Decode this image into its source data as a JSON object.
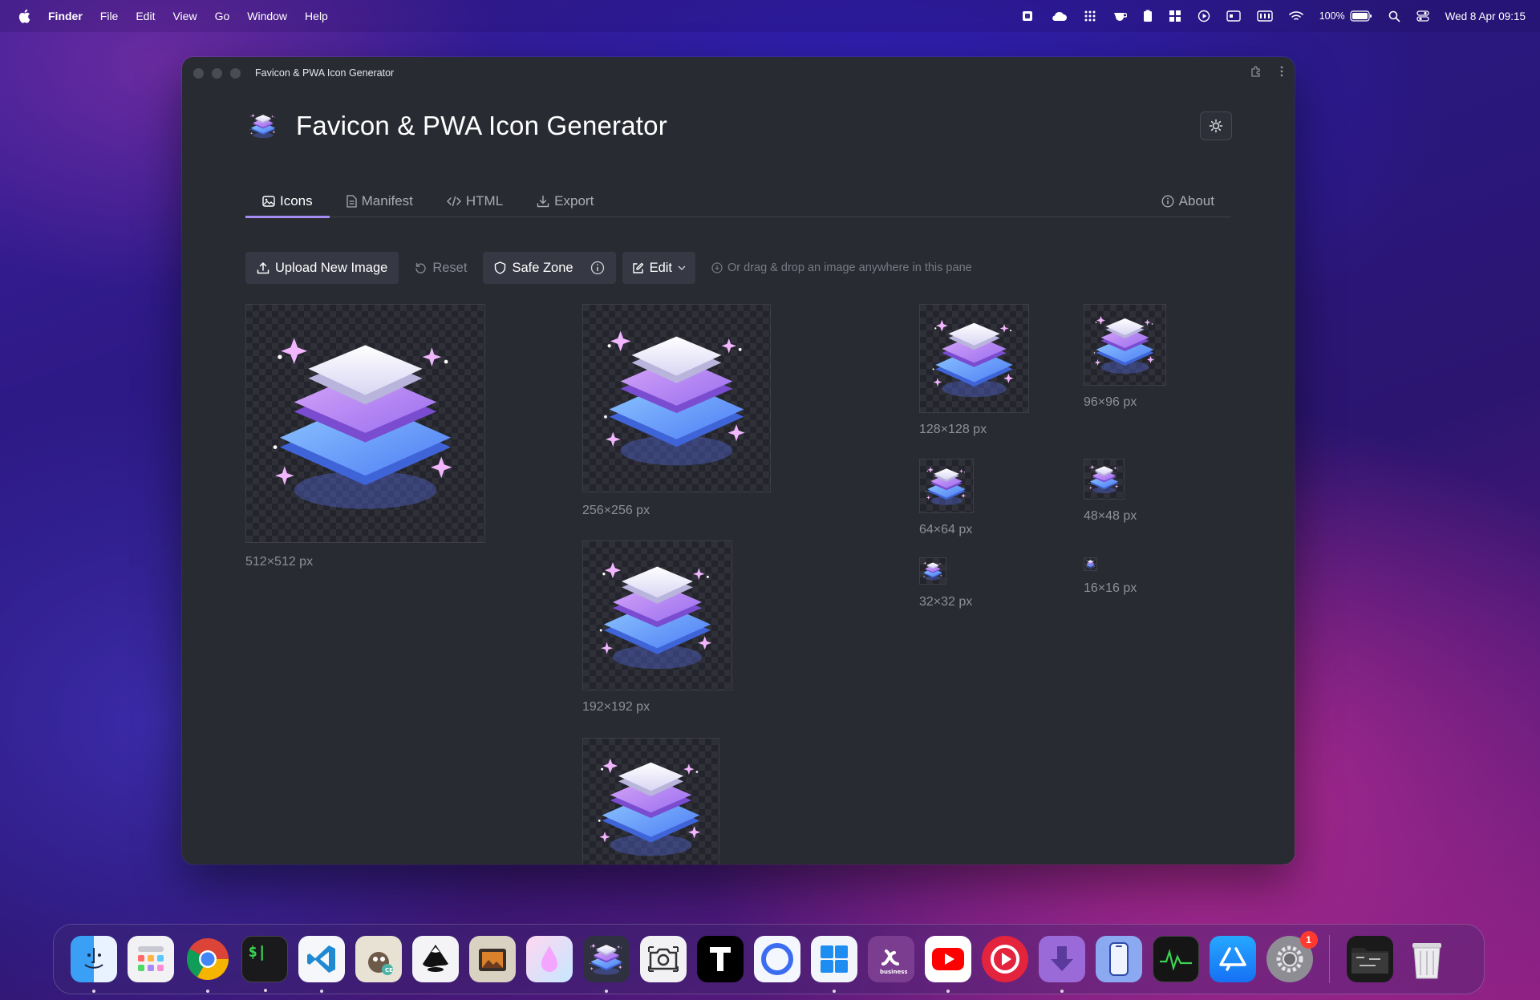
{
  "menubar": {
    "app_name": "Finder",
    "menus": [
      "File",
      "Edit",
      "View",
      "Go",
      "Window",
      "Help"
    ],
    "battery": "100%",
    "datetime": "Wed 8 Apr  09:15"
  },
  "window": {
    "title": "Favicon & PWA Icon Generator"
  },
  "header": {
    "title": "Favicon & PWA Icon Generator"
  },
  "tabs": [
    {
      "label": "Icons",
      "icon": "image-icon",
      "active": true
    },
    {
      "label": "Manifest",
      "icon": "document-icon",
      "active": false
    },
    {
      "label": "HTML",
      "icon": "code-icon",
      "active": false
    },
    {
      "label": "Export",
      "icon": "download-icon",
      "active": false
    }
  ],
  "about_tab": {
    "label": "About",
    "icon": "info-icon"
  },
  "toolbar": {
    "upload_label": "Upload New Image",
    "reset_label": "Reset",
    "safe_zone_label": "Safe Zone",
    "edit_label": "Edit",
    "hint": "Or drag & drop an image anywhere in this pane"
  },
  "previews": [
    {
      "label": "512×512 px"
    },
    {
      "label": "256×256 px"
    },
    {
      "label": "192×192 px"
    },
    {
      "label": "128×128 px"
    },
    {
      "label": "96×96 px"
    },
    {
      "label": "64×64 px"
    },
    {
      "label": "48×48 px"
    },
    {
      "label": "32×32 px"
    },
    {
      "label": "16×16 px"
    },
    {
      "label": ""
    }
  ],
  "dock": {
    "apps": [
      "Finder",
      "Launchpad",
      "Chrome",
      "Terminal",
      "VS Code",
      "GIMP",
      "Inkscape",
      "Photo Booth",
      "Drop",
      "Favicon Generator",
      "Screenshot",
      "Typora",
      "Mirror",
      "Windows App",
      "Splashtop Business",
      "YouTube",
      "Podcast Player",
      "Downloader",
      "iPhone Mirroring",
      "Activity Monitor",
      "App Store",
      "System Settings",
      "Folder",
      "Trash"
    ],
    "settings_badge": "1"
  }
}
